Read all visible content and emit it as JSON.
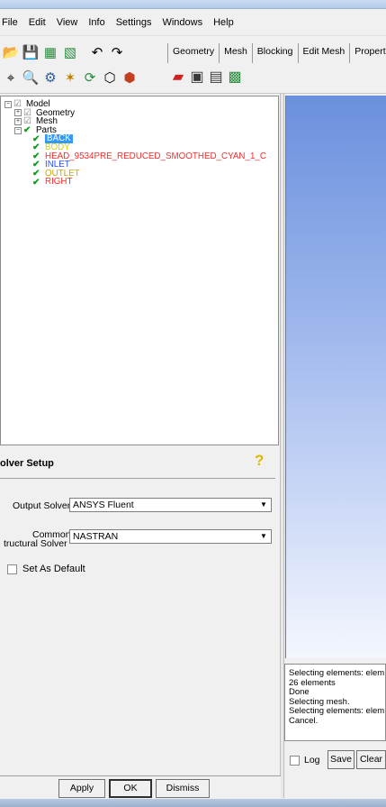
{
  "menubar": {
    "items": [
      "File",
      "Edit",
      "View",
      "Info",
      "Settings",
      "Windows",
      "Help"
    ]
  },
  "toolbar": {
    "row1_icons": [
      "open-folder-icon",
      "save-icon",
      "open-geometry-icon",
      "save-geometry-icon",
      "undo-icon",
      "redo-icon"
    ],
    "row2_icons": [
      "fit-window-icon",
      "zoom-icon",
      "measure-icon",
      "hidden-line-icon",
      "refresh-icon",
      "wireframe-icon",
      "solid-icon"
    ],
    "tabs": [
      "Geometry",
      "Mesh",
      "Blocking",
      "Edit Mesh",
      "Propert"
    ],
    "tab_icons": [
      "boco-icon",
      "solver-icon",
      "output-icon",
      "write-input-icon"
    ]
  },
  "tree": {
    "root": "Model",
    "geometry": "Geometry",
    "mesh": "Mesh",
    "parts": "Parts",
    "part_items": [
      {
        "label": "BACK",
        "color": "#ff3b3b",
        "selected": true
      },
      {
        "label": "BODY",
        "color": "#d4d400"
      },
      {
        "label": "HEAD_9534PRE_REDUCED_SMOOTHED_CYAN_1_C",
        "color": "#ff2a2a"
      },
      {
        "label": "INLET",
        "color": "#2a4dff"
      },
      {
        "label": "OUTLET",
        "color": "#d1a600"
      },
      {
        "label": "RIGHT",
        "color": "#ff2a2a"
      }
    ]
  },
  "solver_setup": {
    "title": "olver Setup",
    "output_solver_label": "Output Solver",
    "output_solver_value": "ANSYS Fluent",
    "structural_label_1": "Common",
    "structural_label_2": "tructural Solver",
    "structural_value": "NASTRAN",
    "default_label": "Set As Default"
  },
  "buttons": {
    "apply": "Apply",
    "ok": "OK",
    "dismiss": "Dismiss"
  },
  "messages": {
    "lines": [
      "Selecting elements: elem",
      "26 elements",
      "Done",
      "Selecting mesh.",
      "Selecting elements: elem",
      "Cancel."
    ],
    "log_label": "Log",
    "save_label": "Save",
    "clear_label": "Clear"
  },
  "colors": {
    "check": "#0e9e1b",
    "selection": "#3399ff",
    "viewport_top": "#6a8fdc",
    "viewport_bottom": "#f3f6fd"
  }
}
